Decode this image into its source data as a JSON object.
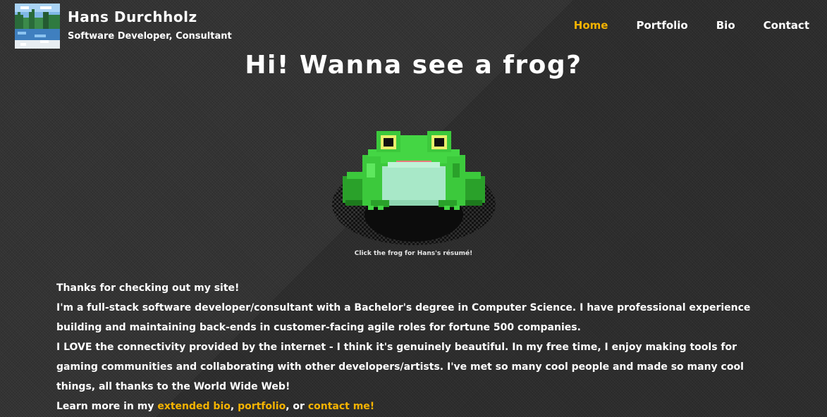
{
  "header": {
    "name": "Hans Durchholz",
    "subtitle": "Software Developer, Consultant",
    "avatar_icon": "pixel-landscape-avatar"
  },
  "nav": {
    "items": [
      {
        "label": "Home",
        "active": true
      },
      {
        "label": "Portfolio",
        "active": false
      },
      {
        "label": "Bio",
        "active": false
      },
      {
        "label": "Contact",
        "active": false
      }
    ]
  },
  "hero": {
    "title": "Hi! Wanna see a frog?",
    "frog_icon": "pixel-frog",
    "caption": "Click the frog for Hans's résumé!"
  },
  "intro": {
    "line1": "Thanks for checking out my site!",
    "line2": "I'm a full-stack software developer/consultant with a Bachelor's degree in Computer Science. I have professional experience building and maintaining back-ends in customer-facing agile roles for fortune 500 companies.",
    "line3": "I LOVE the connectivity provided by the internet - I think it's genuinely beautiful. In my free time, I enjoy making tools for gaming communities and collaborating with other developers/artists. I've met so many cool people and made so many cool things, all thanks to the World Wide Web!",
    "line4_prefix": "Learn more in my ",
    "link_bio": "extended bio",
    "sep1": ", ",
    "link_portfolio": "portfolio",
    "sep2": ", or ",
    "link_contact": "contact me!"
  },
  "colors": {
    "accent": "#f5b301",
    "background": "#333333",
    "text": "#ffffff",
    "frog_green": "#3cc93c",
    "frog_belly": "#a8e8c8"
  }
}
